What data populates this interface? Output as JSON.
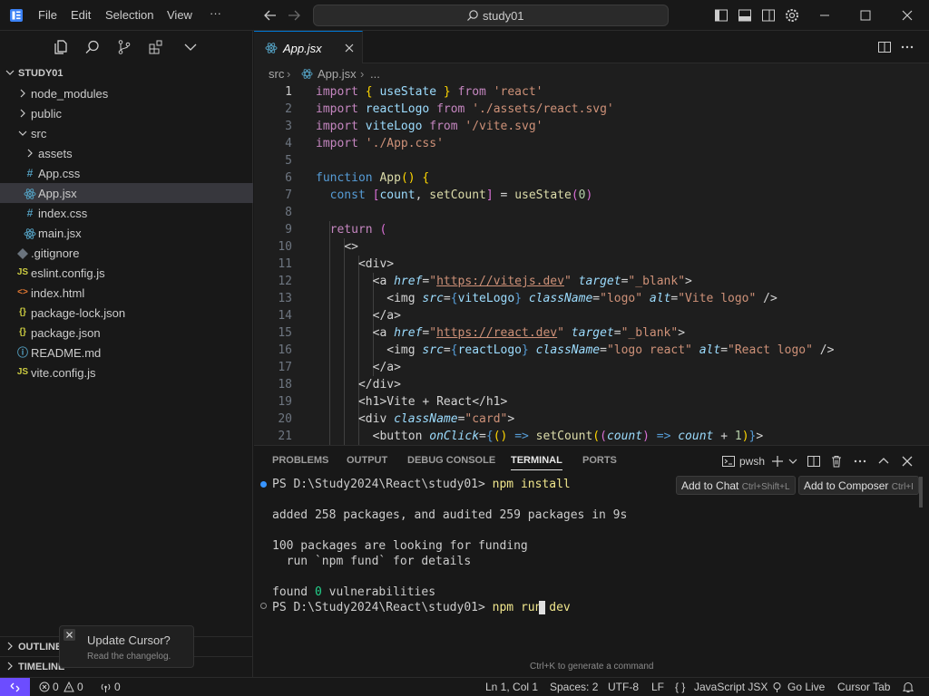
{
  "menu": {
    "file": "File",
    "edit": "Edit",
    "selection": "Selection",
    "view": "View",
    "more": "···"
  },
  "search": {
    "label": "study01"
  },
  "explorer": {
    "title": "STUDY01",
    "items": [
      {
        "label": "node_modules",
        "kind": "folder",
        "icon": ""
      },
      {
        "label": "public",
        "kind": "folder",
        "icon": ""
      },
      {
        "label": "src",
        "kind": "folder-open",
        "icon": ""
      },
      {
        "label": "assets",
        "kind": "folder",
        "icon": ""
      },
      {
        "label": "App.css",
        "kind": "css",
        "icon": "#"
      },
      {
        "label": "App.jsx",
        "kind": "react",
        "icon": ""
      },
      {
        "label": "index.css",
        "kind": "css",
        "icon": "#"
      },
      {
        "label": "main.jsx",
        "kind": "react",
        "icon": ""
      },
      {
        "label": ".gitignore",
        "kind": "git",
        "icon": ""
      },
      {
        "label": "eslint.config.js",
        "kind": "js",
        "icon": "JS"
      },
      {
        "label": "index.html",
        "kind": "html",
        "icon": "<>"
      },
      {
        "label": "package-lock.json",
        "kind": "json",
        "icon": "{}"
      },
      {
        "label": "package.json",
        "kind": "json",
        "icon": "{}"
      },
      {
        "label": "README.md",
        "kind": "info",
        "icon": "ⓘ"
      },
      {
        "label": "vite.config.js",
        "kind": "js",
        "icon": "JS"
      }
    ]
  },
  "sections": {
    "outline": "OUTLINE",
    "timeline": "TIMELINE"
  },
  "notification": {
    "title": "Update Cursor?",
    "body": "Read the changelog."
  },
  "tab": {
    "name": "App.jsx"
  },
  "breadcrumb": {
    "folder": "src",
    "file": "App.jsx",
    "rest": "..."
  },
  "code": {
    "line_numbers": [
      "1",
      "2",
      "3",
      "4",
      "5",
      "6",
      "7",
      "8",
      "9",
      "10",
      "11",
      "12",
      "13",
      "14",
      "15",
      "16",
      "17",
      "18",
      "19",
      "20",
      "21"
    ]
  },
  "panel": {
    "tabs": [
      "PROBLEMS",
      "OUTPUT",
      "DEBUG CONSOLE",
      "TERMINAL",
      "PORTS"
    ],
    "shell": "pwsh",
    "add_to_chat": "Add to Chat",
    "add_to_chat_kb": "Ctrl+Shift+L",
    "add_to_composer": "Add to Composer",
    "add_to_composer_kb": "Ctrl+I",
    "hint": "Ctrl+K to generate a command",
    "terminal": {
      "prompt1": "PS D:\\Study2024\\React\\study01> ",
      "cmd1": "npm install",
      "out1": "added 258 packages, and audited 259 packages in 9s",
      "out2": "100 packages are looking for funding",
      "out3": "  run `npm fund` for details",
      "out4_a": "found ",
      "out4_num": "0",
      "out4_b": " vulnerabilities",
      "prompt2": "PS D:\\Study2024\\React\\study01> ",
      "cmd2": "npm run dev"
    }
  },
  "status": {
    "errors": "0",
    "warnings": "0",
    "ports": "0",
    "position": "Ln 1, Col 1",
    "spaces": "Spaces: 2",
    "encoding": "UTF-8",
    "eol": "LF",
    "language": "JavaScript JSX",
    "golive": "Go Live",
    "cursortab": "Cursor Tab"
  },
  "colors": {
    "accent": "#0078d4",
    "remote": "#6c4dff",
    "react_icon": "#519aba",
    "css_icon": "#519aba",
    "js_icon": "#cbcb41",
    "json_icon": "#cbcb41",
    "html_icon": "#e37933"
  }
}
